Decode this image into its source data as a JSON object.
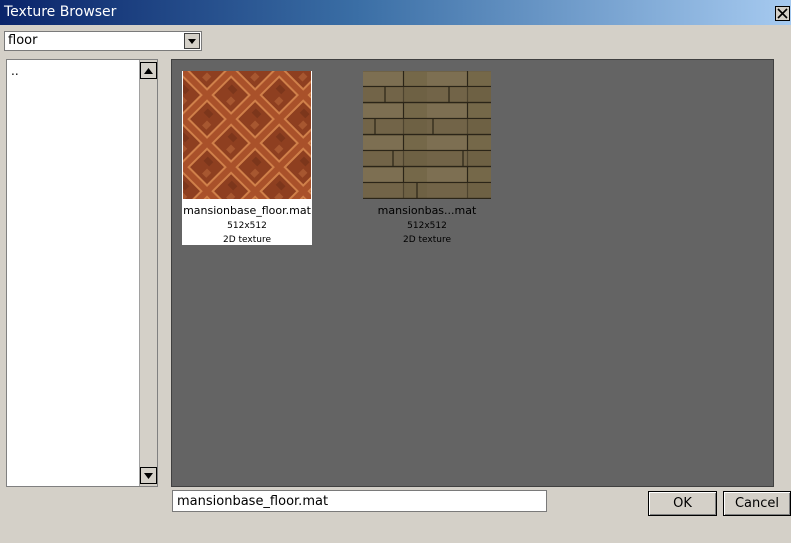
{
  "window": {
    "title": "Texture Browser",
    "close_icon": "close-icon"
  },
  "filter": {
    "value": "floor",
    "arrow_icon": "chevron-down-icon"
  },
  "folders": {
    "items": [
      ".."
    ],
    "scroll_up_icon": "triangle-up-icon",
    "scroll_down_icon": "triangle-down-icon"
  },
  "textures": [
    {
      "name": "mansionbase_floor.mat",
      "size": "512x512",
      "type": "2D texture",
      "selected": true,
      "pattern": "diagonal-orange-tiles"
    },
    {
      "name": "mansionbas...mat",
      "size": "512x512",
      "type": "2D texture",
      "selected": false,
      "pattern": "brown-wood-planks"
    }
  ],
  "path_input": {
    "value": "mansionbase_floor.mat"
  },
  "buttons": {
    "ok": "OK",
    "cancel": "Cancel"
  },
  "colors": {
    "title_gradient_start": "#0a246a",
    "title_gradient_end": "#a6caf0",
    "grid_background": "#646464",
    "dialog_background": "#d4d0c8"
  }
}
